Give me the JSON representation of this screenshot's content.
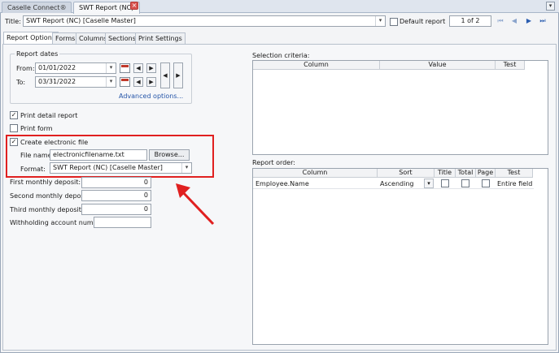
{
  "tabs": [
    {
      "label": "Caselle Connect®",
      "active": false
    },
    {
      "label": "SWT Report (NC)",
      "active": true
    }
  ],
  "title_label": "Title:",
  "title_value": "SWT Report (NC) [Caselle Master]",
  "default_report_label": "Default report",
  "default_report_checked": false,
  "page_indicator": "1 of 2",
  "subtabs": [
    "Report Options",
    "Forms",
    "Columns",
    "Sections",
    "Print Settings"
  ],
  "report_dates": {
    "legend": "Report dates",
    "from_label": "From:",
    "from_value": "01/01/2022",
    "to_label": "To:",
    "to_value": "03/31/2022",
    "advanced_link": "Advanced options..."
  },
  "options": {
    "print_detail_label": "Print detail report",
    "print_detail_checked": true,
    "print_form_label": "Print form",
    "print_form_checked": false,
    "create_file_label": "Create electronic file",
    "create_file_checked": true,
    "file_name_label": "File name:",
    "file_name_value": "electronicfilename.txt",
    "browse_label": "Browse...",
    "format_label": "Format:",
    "format_value": "SWT Report (NC) [Caselle Master]"
  },
  "deposits": {
    "first_label": "First monthly deposit:",
    "first_value": "0",
    "second_label": "Second monthly deposit:",
    "second_value": "0",
    "third_label": "Third monthly deposit:",
    "third_value": "0",
    "withholding_label": "Withholding account number:",
    "withholding_value": ""
  },
  "selection_criteria": {
    "label": "Selection criteria:",
    "columns": [
      "Column",
      "Value",
      "Test"
    ]
  },
  "report_order": {
    "label": "Report order:",
    "columns": [
      "Column",
      "Sort",
      "Title",
      "Total",
      "Page",
      "Test"
    ],
    "rows": [
      {
        "column": "Employee.Name",
        "sort": "Ascending",
        "title": false,
        "total": false,
        "page": false,
        "test": "Entire field"
      }
    ]
  },
  "colors": {
    "highlight": "#e02020",
    "link": "#2555a8",
    "close": "#d9534f"
  }
}
